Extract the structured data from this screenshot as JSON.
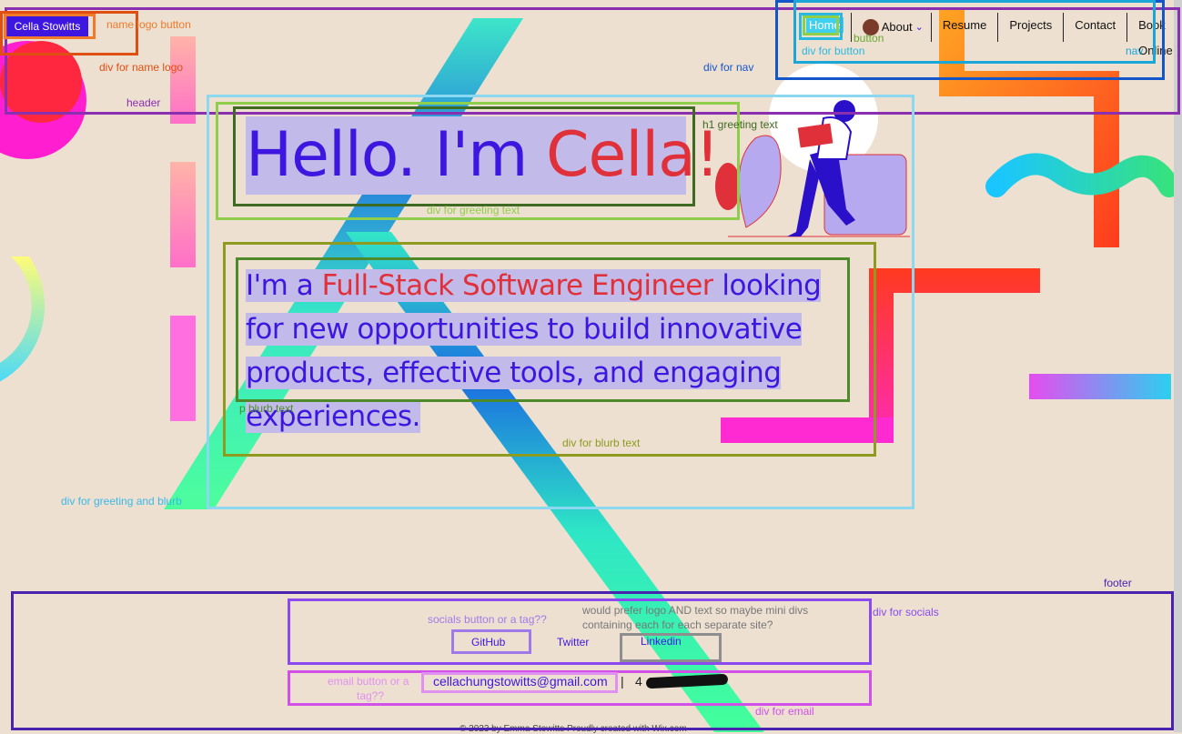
{
  "header": {
    "logo_label": "Cella Stowitts",
    "nav": {
      "items": [
        "Home",
        "About",
        "Resume",
        "Projects",
        "Contact",
        "Book Online"
      ]
    }
  },
  "greeting": {
    "part1": "Hello. I'm ",
    "name": "Cella!",
    "blurb_pre": "I'm a ",
    "blurb_role": "Full-Stack Software Engineer",
    "blurb_post": " looking for new opportunities to build innovative products, effective tools, and engaging experiences."
  },
  "footer": {
    "socials": [
      "GitHub",
      "Twitter",
      "Linkedin"
    ],
    "email": "cellachungstowitts@gmail.com",
    "separator": "|",
    "phone_visible": "4",
    "copyright": "© 2023 by Emma Stowitts Proudly created with Wix.com"
  },
  "annotations": {
    "name_logo_button": "name logo button",
    "div_name_logo": "div for name logo",
    "header": "header",
    "div_nav": "div for nav",
    "button": "button",
    "div_button": "div for button",
    "nav": "nav",
    "h1_greeting": "h1 greeting text",
    "div_greeting": "div for greeting text",
    "p_blurb": "p blurb text",
    "div_blurb": "div for blurb text",
    "div_greeting_blurb": "div for greeting and blurb",
    "footer": "footer",
    "div_socials": "div for socials",
    "socials_button": "socials button or a tag??",
    "socials_note_line1": "would prefer logo AND text so maybe mini divs",
    "socials_note_line2": "containing each for each separate site?",
    "email_button_line1": "email button or a",
    "email_button_line2": "tag??",
    "div_email": "div for email"
  },
  "colors": {
    "background": "#ede0d1",
    "brand_purple": "#3d16e0",
    "accent_red": "#e0303a"
  }
}
